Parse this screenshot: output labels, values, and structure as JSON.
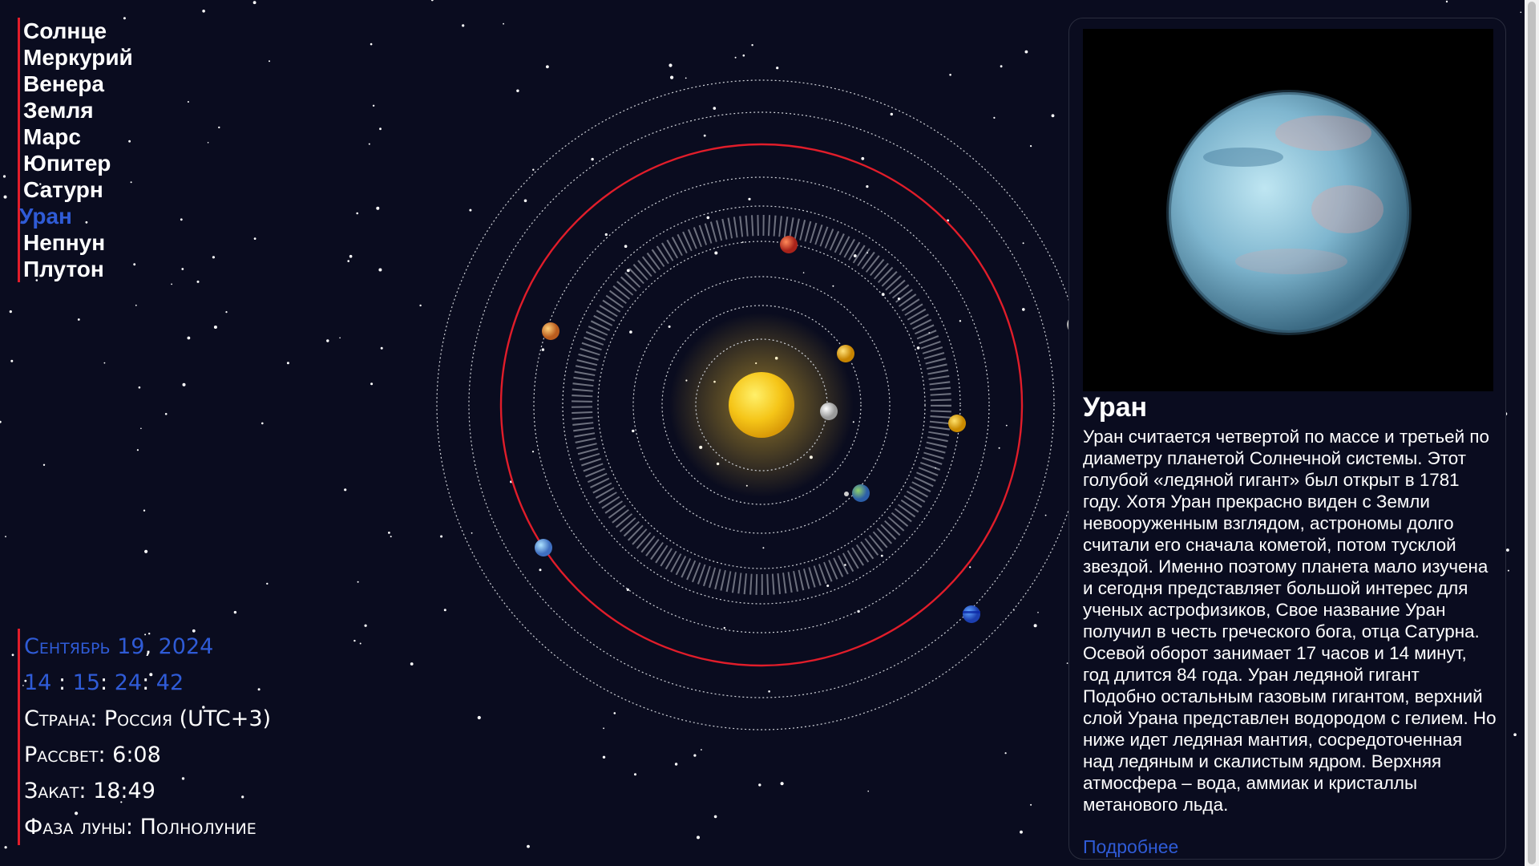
{
  "menu": {
    "items": [
      {
        "label": "Солнце"
      },
      {
        "label": "Меркурий"
      },
      {
        "label": "Венера"
      },
      {
        "label": "Земля"
      },
      {
        "label": "Марс"
      },
      {
        "label": "Юпитер"
      },
      {
        "label": "Сатурн"
      },
      {
        "label": "Уран"
      },
      {
        "label": "Непнун"
      },
      {
        "label": "Плутон"
      }
    ],
    "active_label": "Уран"
  },
  "datetime": {
    "month": "Сентябрь",
    "day": "19",
    "year": "2024",
    "hours": "14",
    "minutes": "15",
    "seconds": "24",
    "ms": "42",
    "sep_comma": ",",
    "sep_colon": ":"
  },
  "location": {
    "country": "Страна: Россия (UTC+3)",
    "sunrise": "Рассвет: 6:08",
    "sunset": "Закат: 18:49",
    "moon_phase": "Фаза луны: Полнолуние"
  },
  "detail": {
    "title": "Уран",
    "description": "Уран считается четвертой по массе и третьей по диаметру планетой Солнечной системы. Этот голубой «ледяной гигант» был открыт в 1781 году. Хотя Уран прекрасно виден с Земли невооруженным взглядом, астрономы долго считали его сначала кометой, потом тусклой звездой. Именно поэтому планета мало изучена и сегодня представляет большой интерес для ученых астрофизиков, Свое название Уран получил в честь греческого бога, отца Сатурна. Осевой оборот занимает 17 часов и 14 минут, год длится 84 года. Уран ледяной гигант Подобно остальным газовым гигантом, верхний слой Урана представлен водородом с гелием. Но ниже идет ледяная мантия, сосредоточенная над ледяным и скалистым ядром. Верхняя атмосфера – вода, аммиак и кристаллы метанового льда.",
    "more_link": "Подробнее"
  },
  "colors": {
    "background": "#0a0c1f",
    "accent_red": "#e11d2a",
    "link_blue": "#2f5bd6",
    "sun": "#f5c518",
    "uranus": "#8fc6da"
  },
  "icons": {
    "sun": "sun-icon",
    "planets": [
      "mercury-icon",
      "venus-icon",
      "earth-icon",
      "mars-icon",
      "jupiter-icon",
      "saturn-icon",
      "uranus-icon",
      "neptune-icon",
      "pluto-icon"
    ]
  }
}
